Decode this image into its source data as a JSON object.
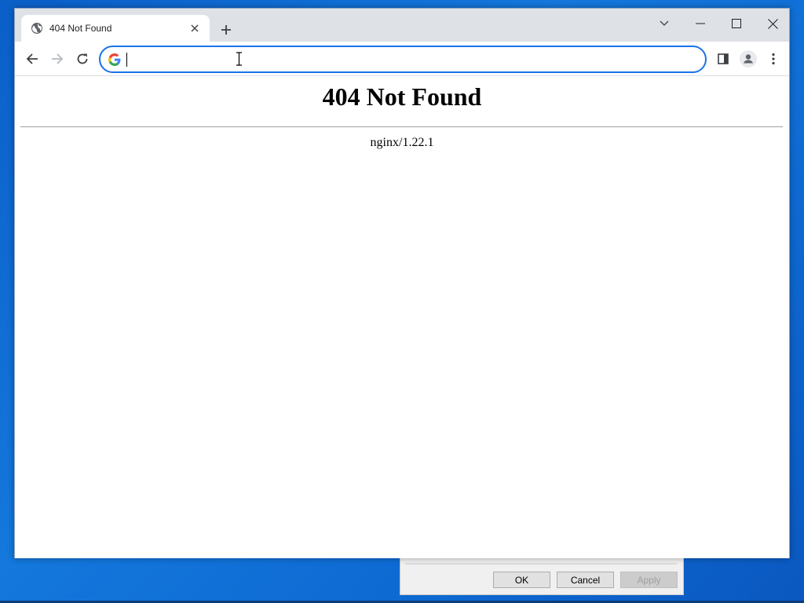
{
  "browser": {
    "tab": {
      "title": "404 Not Found",
      "favicon": "globe-icon",
      "close_icon": "close-icon"
    },
    "new_tab_icon": "plus-icon",
    "window_controls": [
      "tab-search-icon",
      "minimize-icon",
      "maximize-icon",
      "close-icon"
    ],
    "toolbar": {
      "back_icon": "back-arrow-icon",
      "forward_icon": "forward-arrow-icon",
      "reload_icon": "reload-icon",
      "search_engine_icon": "google-icon",
      "address_value": "",
      "side_panel_icon": "side-panel-icon",
      "profile_icon": "profile-icon",
      "menu_icon": "kebab-menu-icon",
      "accent_color": "#1a73e8"
    }
  },
  "page": {
    "heading": "404 Not Found",
    "server_line": "nginx/1.22.1"
  },
  "background_dialog": {
    "ok_label": "OK",
    "cancel_label": "Cancel",
    "apply_label": "Apply"
  }
}
